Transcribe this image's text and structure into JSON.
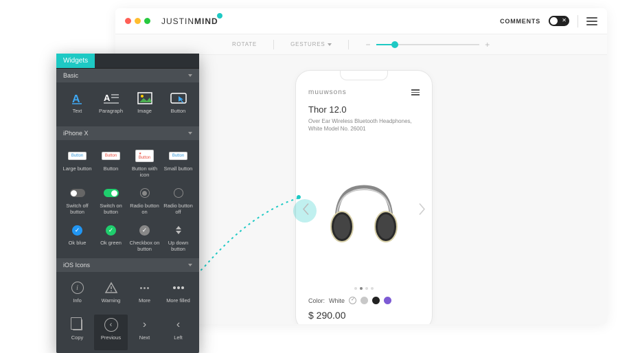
{
  "window": {
    "brand_prefix": "JUST",
    "brand_suffix": "IN",
    "brand_bold": "MIND",
    "comments_label": "COMMENTS"
  },
  "toolbar": {
    "rotate": "ROTATE",
    "gestures": "GESTURES"
  },
  "phone": {
    "brand": "muuwsons",
    "product_title": "Thor 12.0",
    "product_sub": "Over Ear Wireless Bluetooth Headphones, White Model No. 26001",
    "color_label": "Color: ",
    "color_value": "White",
    "price": "$ 290.00",
    "swatches": [
      {
        "name": "white",
        "color": "#ffffff",
        "selected": true
      },
      {
        "name": "silver",
        "color": "#c8c8c8",
        "selected": false
      },
      {
        "name": "black",
        "color": "#222222",
        "selected": false
      },
      {
        "name": "purple",
        "color": "#7d5bd4",
        "selected": false
      }
    ]
  },
  "widgets": {
    "tab": "Widgets",
    "sections": {
      "basic": "Basic",
      "iphonex": "iPhone X",
      "ios_icons": "iOS Icons"
    },
    "basic_items": [
      "Text",
      "Paragraph",
      "Image",
      "Button"
    ],
    "iphonex_row1": [
      "Large button",
      "Button",
      "Button with icon",
      "Small button"
    ],
    "iphonex_row2": [
      "Switch off button",
      "Switch on button",
      "Radio button on",
      "Radio button off"
    ],
    "iphonex_row3": [
      "Ok blue",
      "Ok green",
      "Checkbox on button",
      "Up down button"
    ],
    "ios_row1": [
      "Info",
      "Warning",
      "More",
      "More filled"
    ],
    "ios_row2": [
      "Copy",
      "Previous",
      "Next",
      "Left"
    ],
    "chip_label": "Button"
  }
}
